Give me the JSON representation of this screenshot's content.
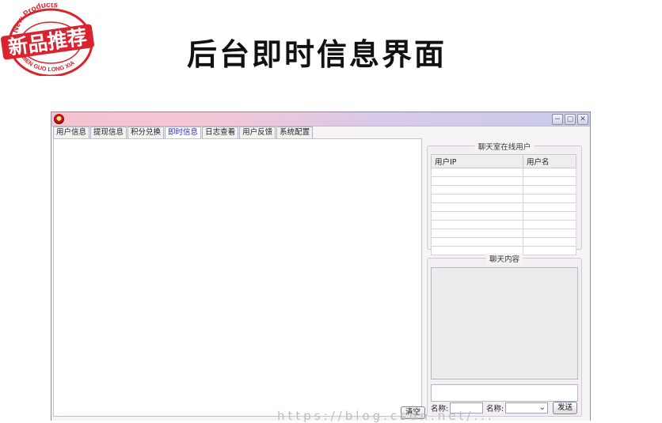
{
  "stamp": {
    "top_text": "New Products",
    "main_text": "新品推荐",
    "bottom_text": "MIEN GUO LONG XIA",
    "color": "#d9232e"
  },
  "page_title": "后台即时信息界面",
  "window": {
    "title_gradient": [
      "#f5c2cf",
      "#c8cbe9"
    ],
    "controls": {
      "minimize": "−",
      "restore": "▢",
      "close": "✕"
    }
  },
  "tabs": [
    {
      "label": "用户信息"
    },
    {
      "label": "提现信息"
    },
    {
      "label": "积分兑换"
    },
    {
      "label": "即时信息",
      "active": true
    },
    {
      "label": "日志查看"
    },
    {
      "label": "用户反馈"
    },
    {
      "label": "系统配置"
    }
  ],
  "main": {
    "clear_button": "清空"
  },
  "online_users": {
    "legend": "聊天室在线用户",
    "columns": [
      "用户IP",
      "用户名"
    ],
    "rows": 10
  },
  "chat": {
    "legend": "聊天内容",
    "name_label_1": "名称:",
    "name_label_2": "名称:",
    "send_button": "发送",
    "select_arrow": "⌄"
  },
  "watermark": "https://blog.csdn.net/..."
}
